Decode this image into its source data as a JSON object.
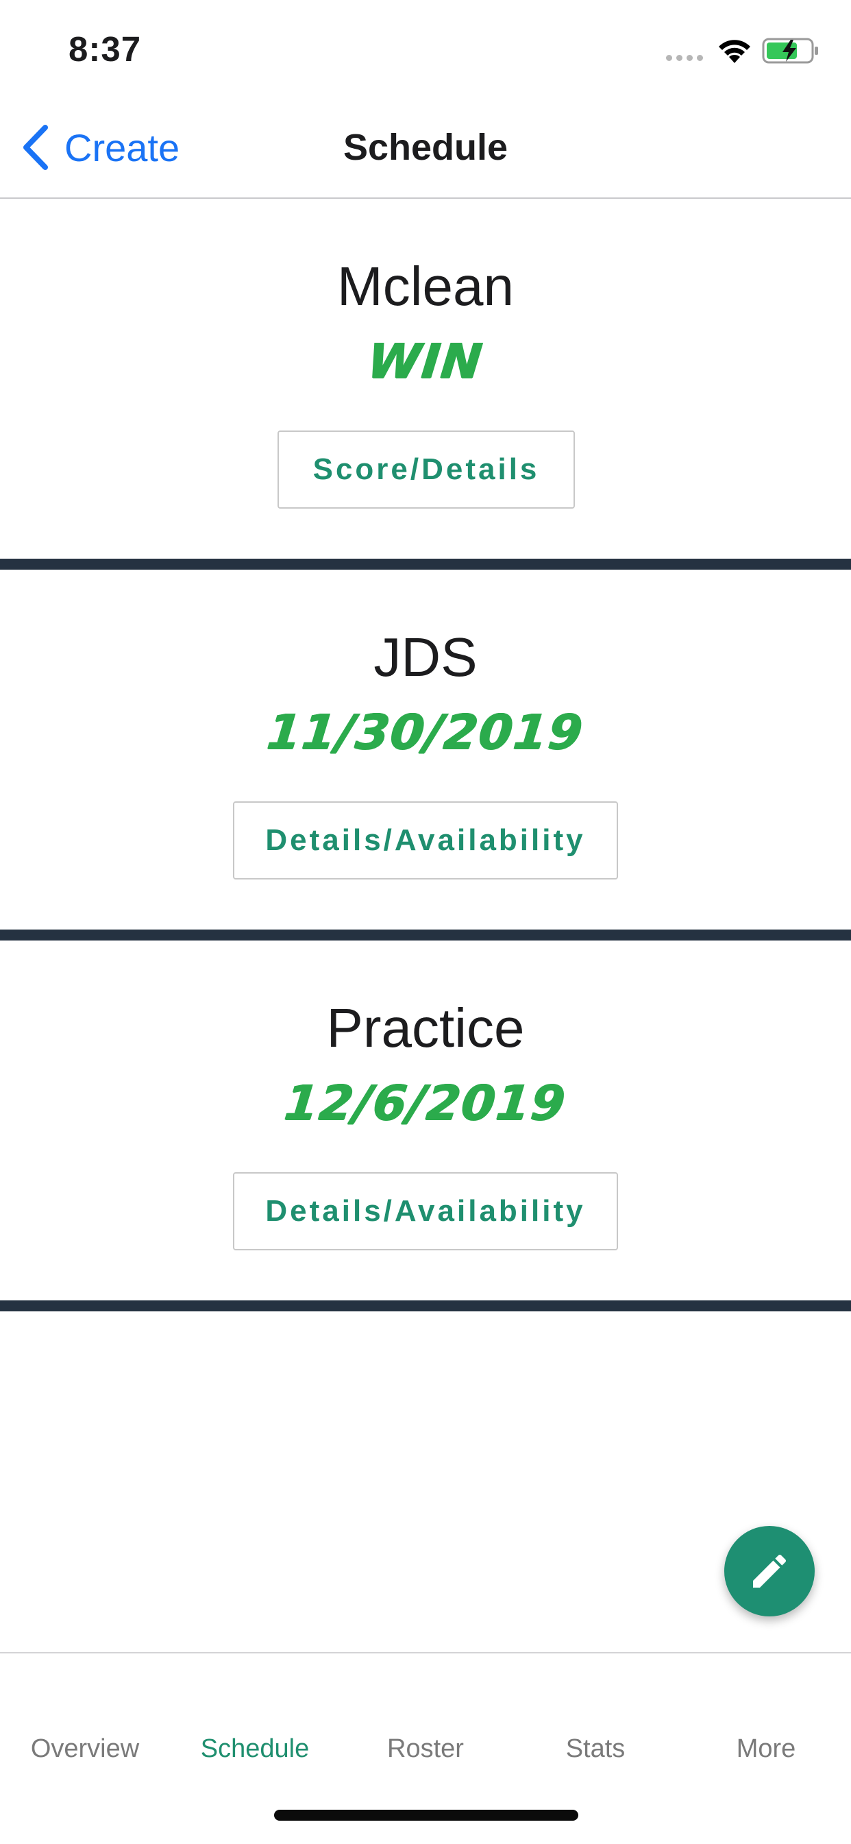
{
  "status_bar": {
    "time": "8:37"
  },
  "nav": {
    "back_label": "Create",
    "title": "Schedule"
  },
  "events": [
    {
      "name": "Mclean",
      "status": "WIN",
      "button": "Score/Details"
    },
    {
      "name": "JDS",
      "status": "11/30/2019",
      "button": "Details/Availability"
    },
    {
      "name": "Practice",
      "status": "12/6/2019",
      "button": "Details/Availability"
    }
  ],
  "fab": {
    "icon": "pencil-icon"
  },
  "tabs": [
    {
      "label": "Overview",
      "active": false
    },
    {
      "label": "Schedule",
      "active": true
    },
    {
      "label": "Roster",
      "active": false
    },
    {
      "label": "Stats",
      "active": false
    },
    {
      "label": "More",
      "active": false
    }
  ],
  "colors": {
    "accent": "#1f8f6f",
    "status_green": "#2bab4c",
    "ios_blue": "#1a73f5",
    "divider": "#253241"
  }
}
